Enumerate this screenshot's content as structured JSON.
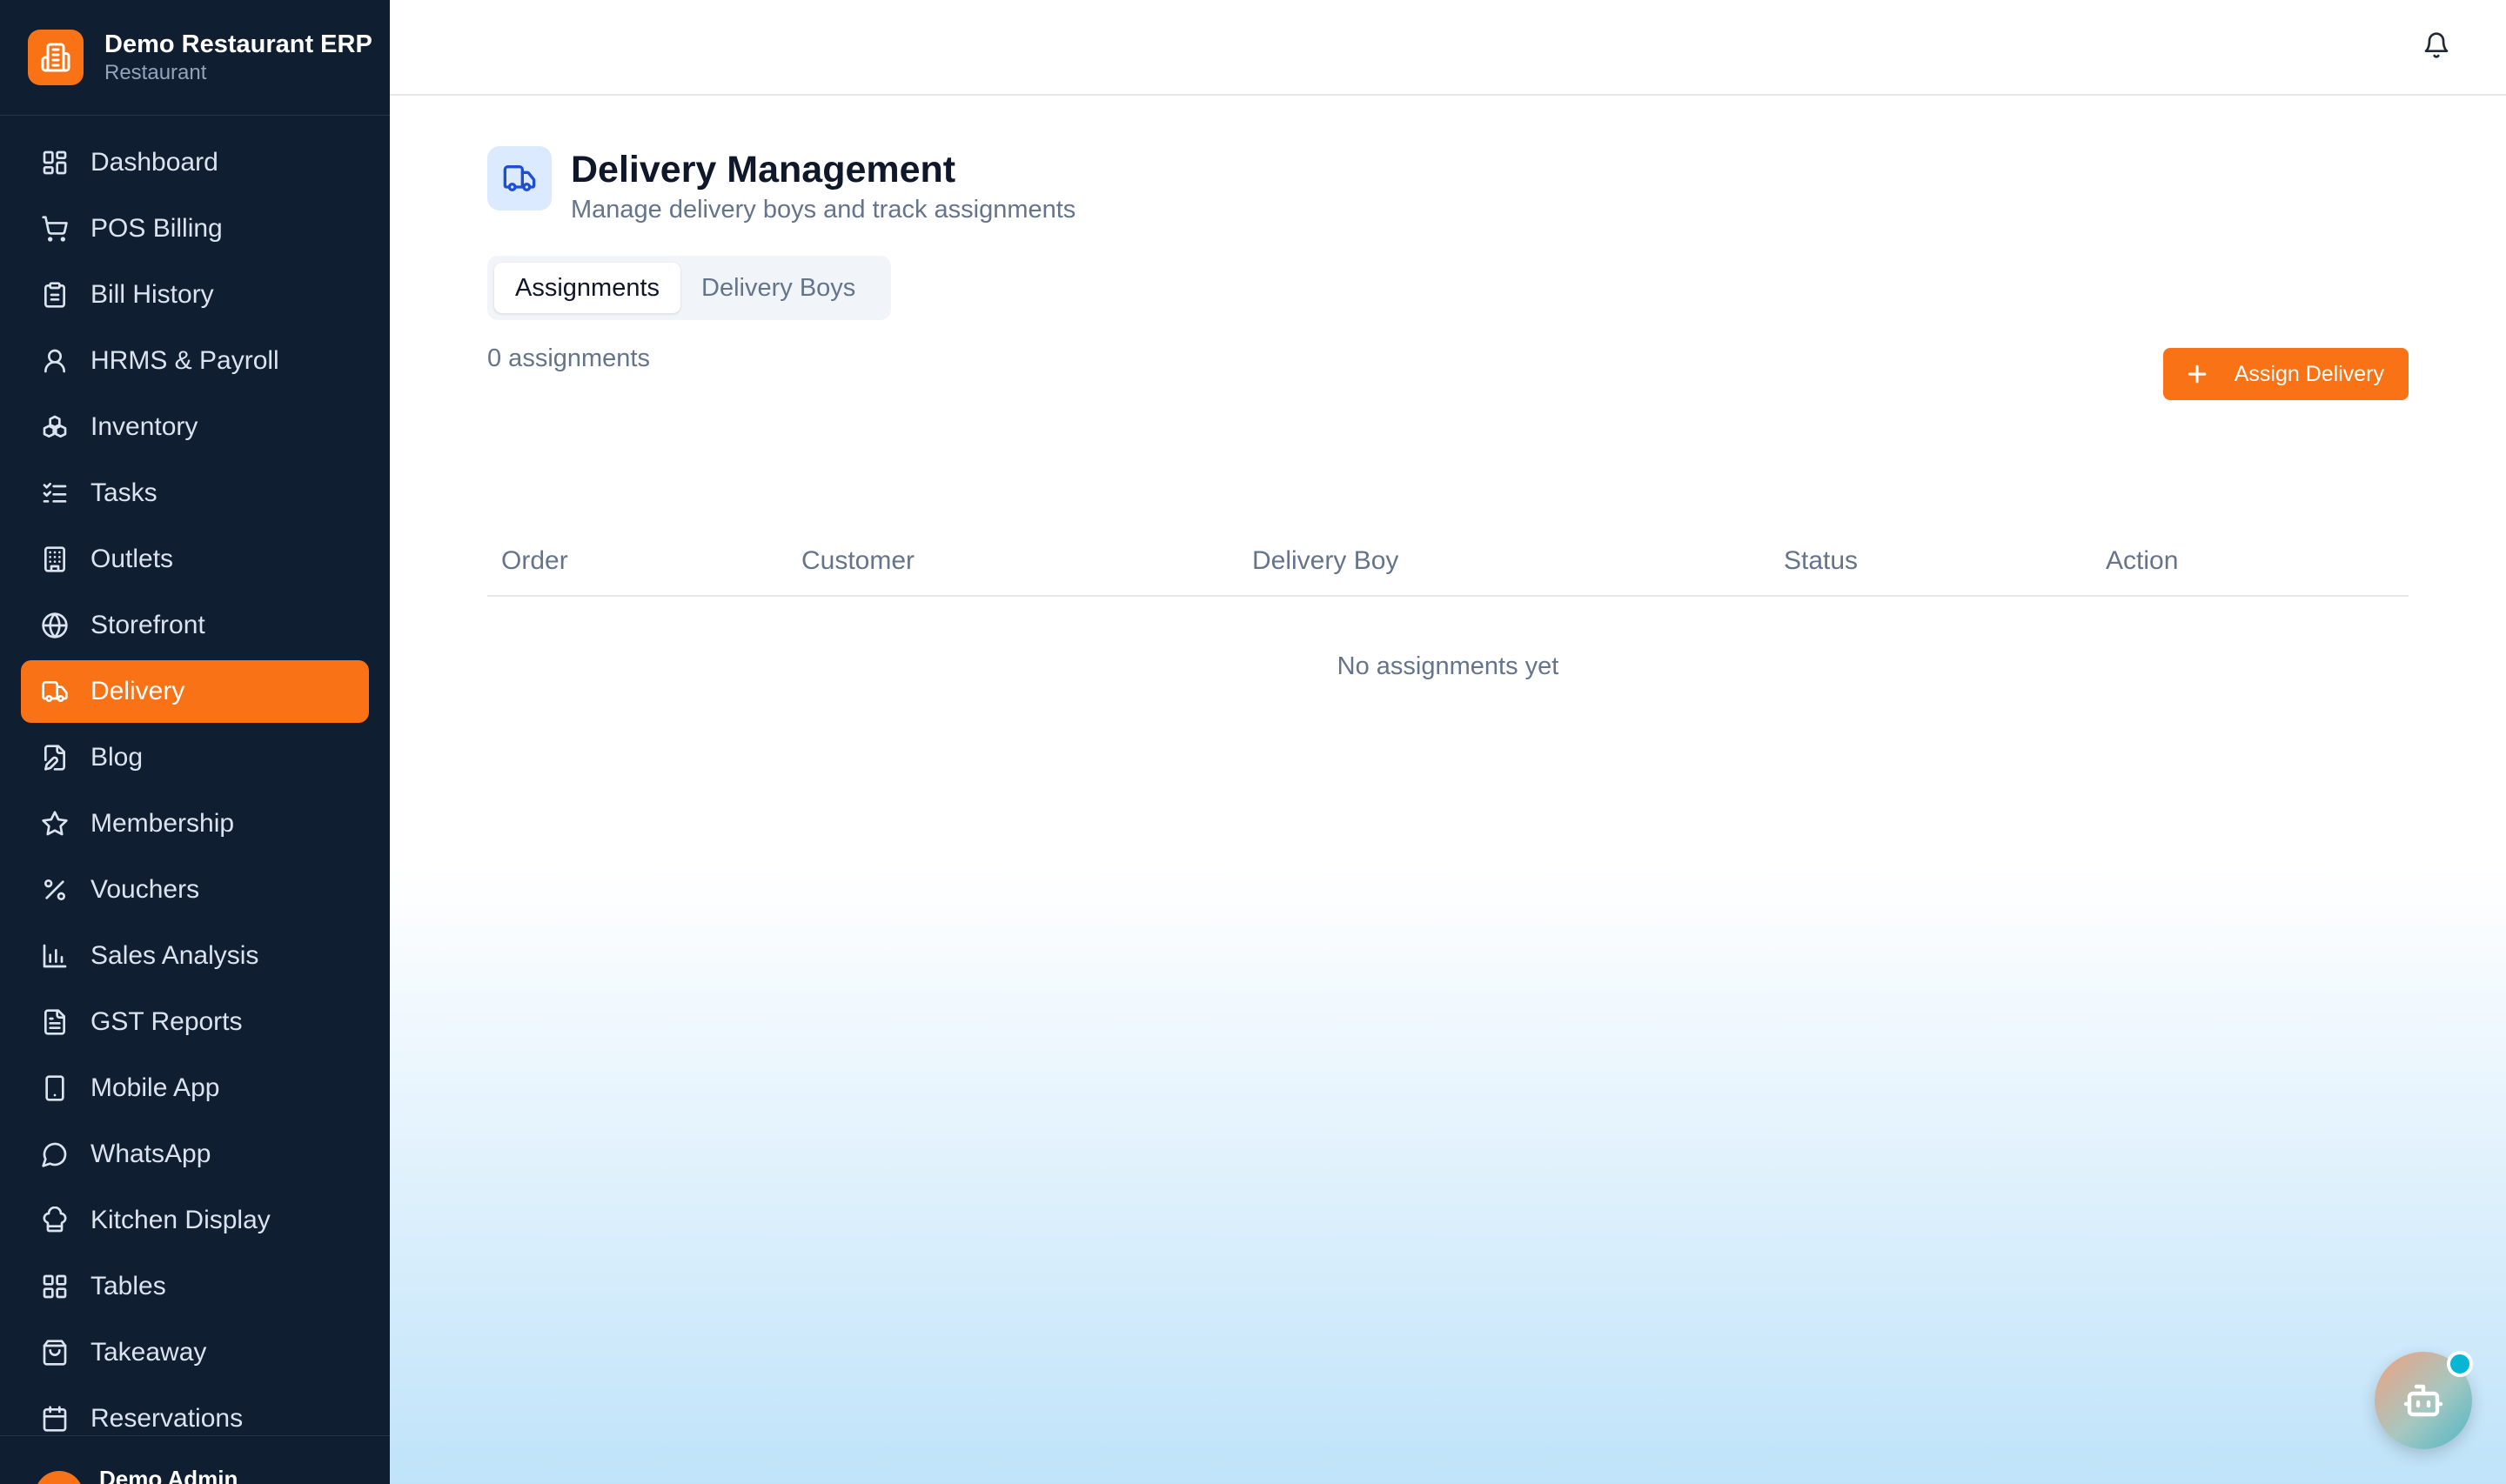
{
  "brand": {
    "title": "Demo Restaurant ERP",
    "subtitle": "Restaurant"
  },
  "sidebar": {
    "items": [
      {
        "label": "Dashboard",
        "icon": "dashboard-icon"
      },
      {
        "label": "POS Billing",
        "icon": "cart-icon"
      },
      {
        "label": "Bill History",
        "icon": "clipboard-icon"
      },
      {
        "label": "HRMS & Payroll",
        "icon": "user-icon"
      },
      {
        "label": "Inventory",
        "icon": "boxes-icon"
      },
      {
        "label": "Tasks",
        "icon": "checklist-icon"
      },
      {
        "label": "Outlets",
        "icon": "building-icon"
      },
      {
        "label": "Storefront",
        "icon": "globe-icon"
      },
      {
        "label": "Delivery",
        "icon": "truck-icon",
        "active": true
      },
      {
        "label": "Blog",
        "icon": "file-pen-icon"
      },
      {
        "label": "Membership",
        "icon": "star-icon"
      },
      {
        "label": "Vouchers",
        "icon": "percent-icon"
      },
      {
        "label": "Sales Analysis",
        "icon": "bar-chart-icon"
      },
      {
        "label": "GST Reports",
        "icon": "document-icon"
      },
      {
        "label": "Mobile App",
        "icon": "smartphone-icon"
      },
      {
        "label": "WhatsApp",
        "icon": "chat-icon"
      },
      {
        "label": "Kitchen Display",
        "icon": "chef-hat-icon"
      },
      {
        "label": "Tables",
        "icon": "grid-icon"
      },
      {
        "label": "Takeaway",
        "icon": "bag-icon"
      },
      {
        "label": "Reservations",
        "icon": "calendar-icon"
      }
    ],
    "footer_name": "Demo Admin"
  },
  "header": {
    "title": "Delivery Management",
    "subtitle": "Manage delivery boys and track assignments"
  },
  "tabs": [
    {
      "label": "Assignments",
      "active": true
    },
    {
      "label": "Delivery Boys",
      "active": false
    }
  ],
  "assignments": {
    "count_text": "0 assignments",
    "button_label": "Assign Delivery",
    "columns": [
      "Order",
      "Customer",
      "Delivery Boy",
      "Status",
      "Action"
    ],
    "rows": [],
    "empty_text": "No assignments yet"
  },
  "colors": {
    "accent": "#f97316",
    "sidebar_bg": "#0f1e30",
    "icon_bg": "#dbeafe"
  }
}
